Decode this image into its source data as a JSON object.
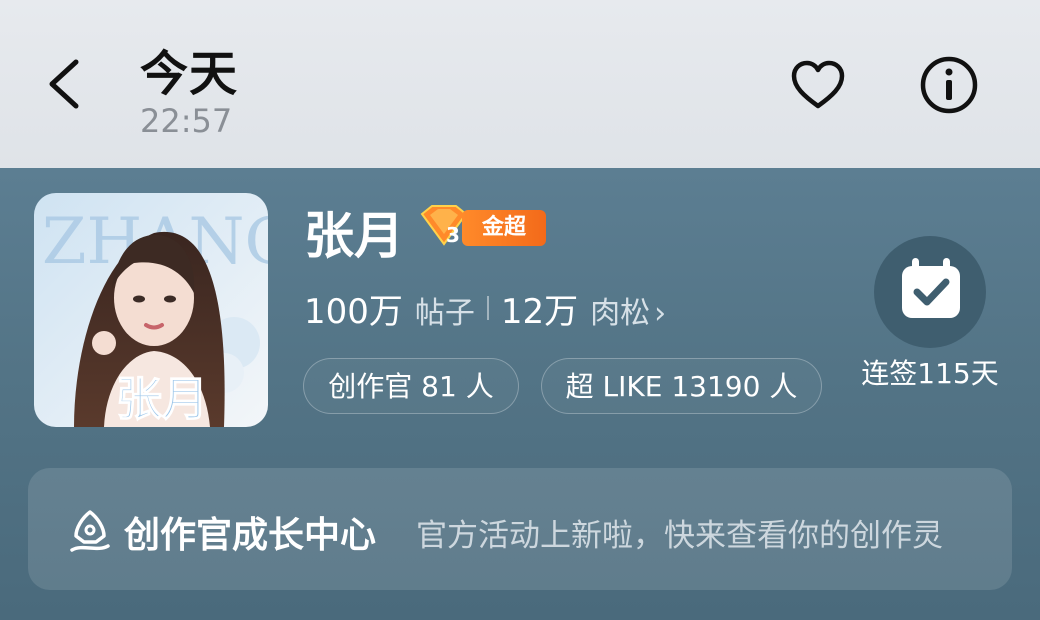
{
  "header": {
    "title": "今天",
    "subtitle": "22:57",
    "back_icon": "chevron-left-icon",
    "favorite_icon": "heart-icon",
    "info_icon": "info-icon"
  },
  "profile": {
    "name": "张月",
    "badge": {
      "level": "3",
      "label": "金超",
      "icon": "diamond-level-icon"
    },
    "posts_count": "100万",
    "posts_label": "帖子",
    "followers_count": "12万",
    "followers_label": "肉松",
    "chips": [
      "创作官 81 人",
      "超 LIKE 13190 人"
    ],
    "checkin_label": "连签115天",
    "checkin_icon": "calendar-check-icon",
    "cover_text": {
      "banner": "ZHANG",
      "overlay_name": "张月"
    }
  },
  "creator_center": {
    "icon": "pen-icon",
    "title": "创作官成长中心",
    "description": "官方活动上新啦，快来查看你的创作灵"
  },
  "colors": {
    "panel": "#537486",
    "badge_orange": "#f36a1a",
    "checkin_circle": "#3f5e6f"
  }
}
